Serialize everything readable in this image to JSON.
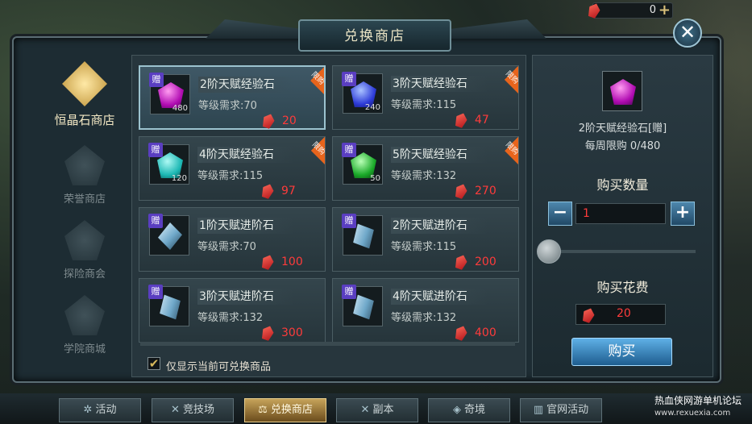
{
  "header": {
    "title": "兑换商店",
    "close_icon": "✕"
  },
  "currency": {
    "value": "0",
    "plus": "+"
  },
  "nav": {
    "items": [
      {
        "label": "恒晶石商店",
        "active": true
      },
      {
        "label": "荣誉商店",
        "active": false
      },
      {
        "label": "探险商会",
        "active": false
      },
      {
        "label": "学院商城",
        "active": false
      }
    ]
  },
  "items": [
    {
      "name": "2阶天赋经验石",
      "req": "等级需求:70",
      "price": "20",
      "gift": "赠",
      "qty": "480",
      "limited": "限购",
      "icon": "pink-stone"
    },
    {
      "name": "3阶天赋经验石",
      "req": "等级需求:115",
      "price": "47",
      "gift": "赠",
      "qty": "240",
      "limited": "限购",
      "icon": "blue-stone"
    },
    {
      "name": "4阶天赋经验石",
      "req": "等级需求:115",
      "price": "97",
      "gift": "赠",
      "qty": "120",
      "limited": "限购",
      "icon": "cyan-stone"
    },
    {
      "name": "5阶天赋经验石",
      "req": "等级需求:132",
      "price": "270",
      "gift": "赠",
      "qty": "50",
      "limited": "限购",
      "icon": "green-stone"
    },
    {
      "name": "1阶天赋进阶石",
      "req": "等级需求:70",
      "price": "100",
      "gift": "赠",
      "qty": "",
      "limited": "",
      "icon": "crystal"
    },
    {
      "name": "2阶天赋进阶石",
      "req": "等级需求:115",
      "price": "200",
      "gift": "赠",
      "qty": "",
      "limited": "",
      "icon": "crystal"
    },
    {
      "name": "3阶天赋进阶石",
      "req": "等级需求:132",
      "price": "300",
      "gift": "赠",
      "qty": "",
      "limited": "",
      "icon": "crystal"
    },
    {
      "name": "4阶天赋进阶石",
      "req": "等级需求:132",
      "price": "400",
      "gift": "赠",
      "qty": "",
      "limited": "",
      "icon": "crystal"
    }
  ],
  "filter": {
    "label": "仅显示当前可兑换商品",
    "checked": true,
    "check_mark": "✔"
  },
  "detail": {
    "name": "2阶天赋经验石[赠]",
    "weekly_limit": "每周限购 0/480",
    "quantity_label": "购买数量",
    "quantity": "1",
    "minus": "−",
    "plus": "+",
    "cost_label": "购买花费",
    "cost": "20",
    "buy_label": "购买"
  },
  "bottom_tabs": [
    {
      "label": "活动",
      "icon": "✲"
    },
    {
      "label": "竞技场",
      "icon": "✕"
    },
    {
      "label": "兑换商店",
      "icon": "⚖",
      "active": true
    },
    {
      "label": "副本",
      "icon": "✕"
    },
    {
      "label": "奇境",
      "icon": "◈"
    },
    {
      "label": "官网活动",
      "icon": "▥"
    }
  ],
  "watermark": {
    "text": "热血侠网游单机论坛",
    "url": "www.rexuexia.com"
  },
  "colors": {
    "price": "#ff3b3b",
    "limited_tag": "#e7641c",
    "buy_button": "#2f7fb8",
    "active_tab": "#c6a35a"
  }
}
